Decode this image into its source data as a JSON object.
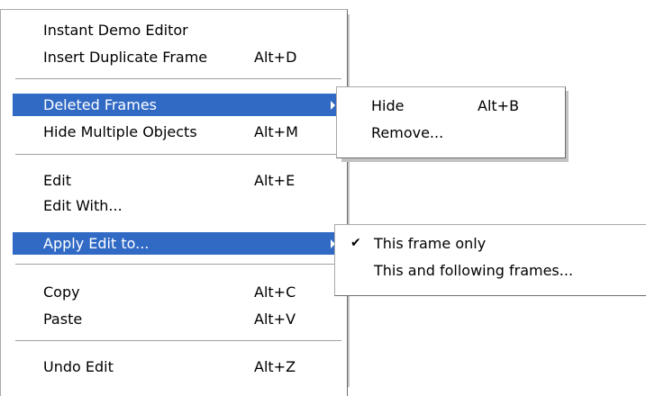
{
  "main_menu": {
    "items": [
      {
        "label": "Instant Demo Editor",
        "shortcut": ""
      },
      {
        "label": "Insert Duplicate Frame",
        "shortcut": "Alt+D"
      },
      {
        "label": "Deleted Frames",
        "shortcut": ""
      },
      {
        "label": "Hide Multiple Objects",
        "shortcut": "Alt+M"
      },
      {
        "label": "Edit",
        "shortcut": "Alt+E"
      },
      {
        "label": "Edit With...",
        "shortcut": ""
      },
      {
        "label": "Apply Edit to...",
        "shortcut": ""
      },
      {
        "label": "Copy",
        "shortcut": "Alt+C"
      },
      {
        "label": "Paste",
        "shortcut": "Alt+V"
      },
      {
        "label": "Undo Edit",
        "shortcut": "Alt+Z"
      }
    ]
  },
  "deleted_frames_submenu": {
    "items": [
      {
        "label": "Hide",
        "shortcut": "Alt+B"
      },
      {
        "label": "Remove...",
        "shortcut": ""
      }
    ]
  },
  "apply_edit_submenu": {
    "items": [
      {
        "label": "This frame only",
        "checked": true,
        "check_glyph": "✔"
      },
      {
        "label": "This and following frames...",
        "checked": false
      }
    ]
  },
  "colors": {
    "highlight": "#316ac5",
    "highlight_text": "#ffffff",
    "menu_background": "#ffffff"
  }
}
